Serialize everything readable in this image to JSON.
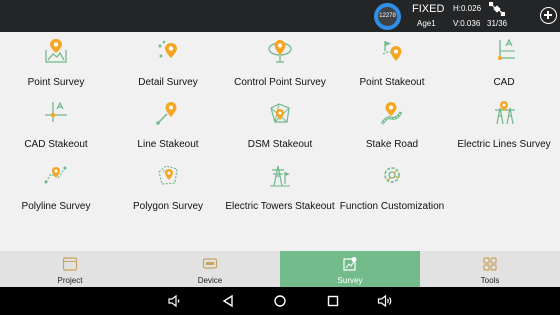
{
  "status": {
    "satellites_visible": "12278",
    "fix_status": "FIXED",
    "age": "Age1",
    "h_rms": "H:0.026",
    "v_rms": "V:0.036",
    "satellites_used": "31/36"
  },
  "colors": {
    "icon_orange": "#f5a623",
    "icon_green": "#72b88a",
    "active_tab": "#74bb8c",
    "ring_blue": "#2e8ee8"
  },
  "menu": {
    "items": [
      {
        "label": "Point Survey",
        "icon": "point-survey-icon"
      },
      {
        "label": "Detail Survey",
        "icon": "detail-survey-icon"
      },
      {
        "label": "Control Point Survey",
        "icon": "control-point-survey-icon"
      },
      {
        "label": "Point Stakeout",
        "icon": "point-stakeout-icon"
      },
      {
        "label": "CAD",
        "icon": "cad-icon"
      },
      {
        "label": "CAD Stakeout",
        "icon": "cad-stakeout-icon"
      },
      {
        "label": "Line Stakeout",
        "icon": "line-stakeout-icon"
      },
      {
        "label": "DSM Stakeout",
        "icon": "dsm-stakeout-icon"
      },
      {
        "label": "Stake Road",
        "icon": "stake-road-icon"
      },
      {
        "label": "Electric Lines Survey",
        "icon": "electric-lines-survey-icon"
      },
      {
        "label": "Polyline Survey",
        "icon": "polyline-survey-icon"
      },
      {
        "label": "Polygon Survey",
        "icon": "polygon-survey-icon"
      },
      {
        "label": "Electric Towers Stakeout",
        "icon": "electric-towers-stakeout-icon"
      },
      {
        "label": "Function Customization",
        "icon": "function-customization-icon"
      }
    ]
  },
  "tabs": [
    {
      "label": "Project",
      "icon": "project-icon"
    },
    {
      "label": "Device",
      "icon": "device-icon"
    },
    {
      "label": "Survey",
      "icon": "survey-icon",
      "active": true
    },
    {
      "label": "Tools",
      "icon": "tools-icon"
    }
  ],
  "nav": [
    "volume-down-icon",
    "back-icon",
    "home-icon",
    "recents-icon",
    "volume-up-icon"
  ]
}
